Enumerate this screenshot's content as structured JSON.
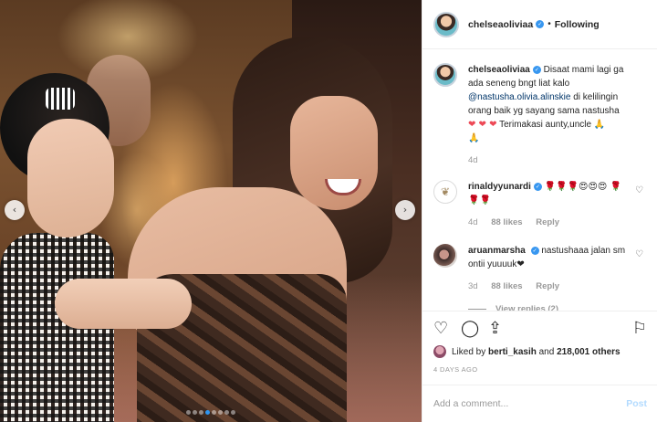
{
  "post": {
    "username": "chelseaoliviaa",
    "follow_state": "Following",
    "carousel_dots": 8,
    "carousel_active_index": 3
  },
  "caption": {
    "username": "chelseaoliviaa",
    "text_before": "Disaat mami lagi ga ada seneng bngt liat kalo",
    "mention": "@nastusha.olivia.alinskie",
    "text_after": "di kelilingin orang baik yg sayang sama nastusha",
    "hearts": "❤ ❤ ❤",
    "text_end": "Terimakasi aunty,uncle",
    "emoji_end": "🙏",
    "emoji_extra": "🙏",
    "time": "4d"
  },
  "comments": [
    {
      "username": "rinaldyyunardi",
      "text": "🌹🌹🌹😍😍😍 🌹🌹🌹",
      "time": "4d",
      "likes": "88 likes",
      "reply": "Reply"
    },
    {
      "username": "aruanmarsha",
      "text": "nastushaaa jalan sm ontii yuuuuk❤",
      "time": "3d",
      "likes": "88 likes",
      "reply": "Reply",
      "view_replies": "View replies (2)"
    }
  ],
  "likes": {
    "prefix": "Liked by",
    "user": "berti_kasih",
    "joiner": "and",
    "others": "218,001 others"
  },
  "date": "4 DAYS AGO",
  "add_comment": {
    "placeholder": "Add a comment...",
    "post_label": "Post"
  },
  "icons": {
    "verified": "verified-icon",
    "like": "heart-icon",
    "comment": "comment-icon",
    "share": "share-icon",
    "save": "bookmark-icon",
    "prev": "chevron-left-icon",
    "next": "chevron-right-icon"
  },
  "colors": {
    "verified": "#3897f0",
    "mention": "#003569",
    "heart": "#ed4956",
    "post_disabled": "#b3dbff",
    "dot_active": "#2f95f0"
  }
}
